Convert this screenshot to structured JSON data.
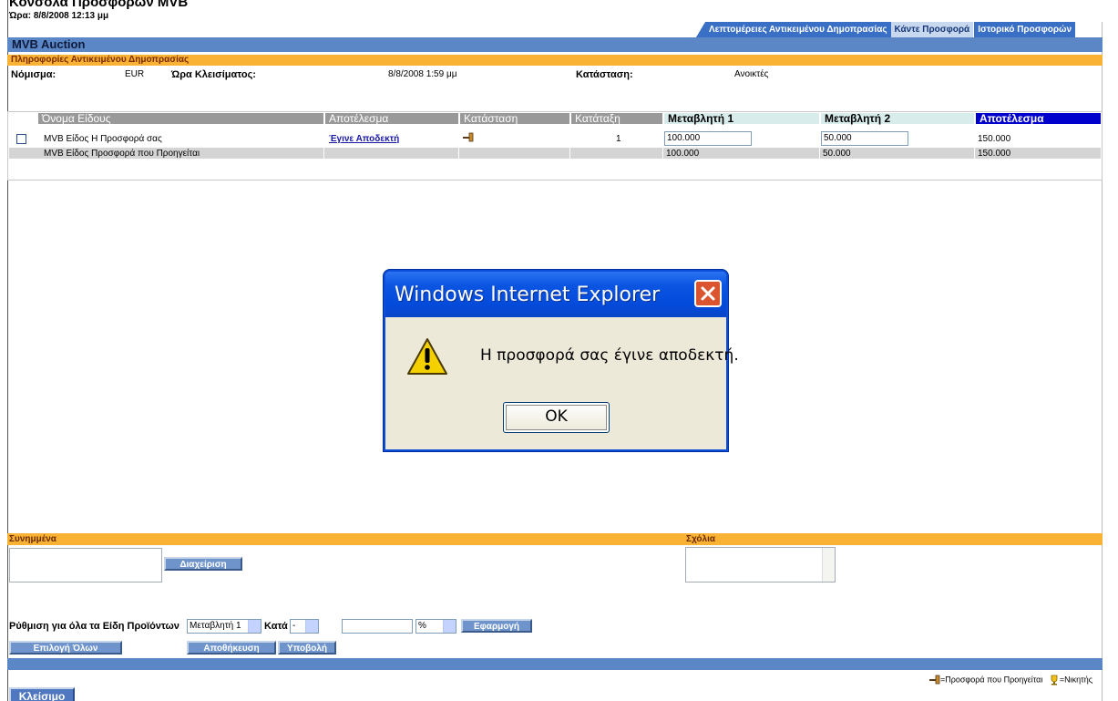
{
  "header": {
    "title": "Κονσόλα Προσφορών MVB",
    "time": "Ώρα: 8/8/2008 12:13 μμ",
    "tabs": [
      "Λεπτομέρειες Αντικειμένου Δημοπρασίας",
      "Κάντε Προσφορά",
      "Ιστορικό Προσφορών"
    ],
    "active_tab": 1
  },
  "auction_bar": "MVB Auction",
  "info": {
    "section": "Πληροφορίες Αντικειμένου Δημοπρασίας",
    "currency_label": "Νόμισμα:",
    "currency_value": "EUR",
    "closing_label": "Ώρα Κλεισίματος:",
    "closing_value": "8/8/2008 1:59 μμ",
    "status_label": "Κατάσταση:",
    "status_value": "Ανοικτές"
  },
  "table": {
    "columns": [
      "Όνομα Είδους",
      "Αποτέλεσμα",
      "Κατάσταση",
      "Κατάταξη",
      "Μεταβλητή 1",
      "Μεταβλητή 2",
      "Αποτέλεσμα"
    ],
    "rows": [
      {
        "name": "MVB Είδος Η Προσφορά σας",
        "result": "Έγινε Αποδεκτή",
        "rank": "1",
        "var1": "100.000",
        "var2": "50.000",
        "total": "150.000"
      },
      {
        "name": "MVB Είδος Προσφορά που Προηγείται",
        "result": "",
        "rank": "",
        "var1": "100.000",
        "var2": "50.000",
        "total": "150.000"
      }
    ]
  },
  "dialog": {
    "title": "Windows Internet Explorer",
    "message": "Η προσφορά σας έγινε αποδεκτή.",
    "ok_label": "OK"
  },
  "attachments": {
    "label": "Συνημμένα",
    "manage_button": "Διαχείριση"
  },
  "comments": {
    "label": "Σχόλια"
  },
  "adjust": {
    "label": "Ρύθμιση για όλα τα Είδη Προϊόντων",
    "variable_select": "Μεταβλητή 1",
    "by_label": "Κατά",
    "sign_select": "-",
    "amount_value": "",
    "unit_select": "%",
    "apply_button": "Εφαρμογή"
  },
  "buttons": {
    "select_all": "Επιλογή Όλων",
    "save": "Αποθήκευση",
    "submit": "Υποβολή",
    "close": "Κλείσιμο"
  },
  "legend": {
    "leading": "=Προσφορά που Προηγείται",
    "winner": "=Νικητής"
  },
  "colors": {
    "tab_blue": "#3a6fc6",
    "section_orange": "#f9b233",
    "result_header": "#0000cc",
    "dialog_title": "#0b55e2"
  }
}
